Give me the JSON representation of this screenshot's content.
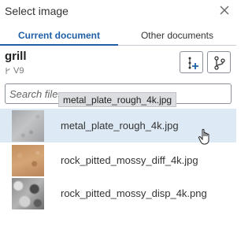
{
  "dialog": {
    "title": "Select image",
    "close_icon": "close-icon"
  },
  "tabs": [
    {
      "label": "Current document",
      "active": true
    },
    {
      "label": "Other documents",
      "active": false
    }
  ],
  "document": {
    "name": "grill",
    "version": "V9",
    "version_icon": "branch-small-icon"
  },
  "toolbar": {
    "insert_icon": "insert-part-icon",
    "branch_icon": "branch-icon"
  },
  "search": {
    "placeholder": "Search files"
  },
  "tooltip": {
    "text": "metal_plate_rough_4k.jpg"
  },
  "files": [
    {
      "name": "metal_plate_rough_4k.jpg",
      "selected": true
    },
    {
      "name": "rock_pitted_mossy_diff_4k.jpg",
      "selected": false
    },
    {
      "name": "rock_pitted_mossy_disp_4k.png",
      "selected": false
    }
  ],
  "colors": {
    "accent": "#1f5fa8",
    "selected_row": "#ddeaf6",
    "tooltip_bg": "#dcdde0"
  }
}
